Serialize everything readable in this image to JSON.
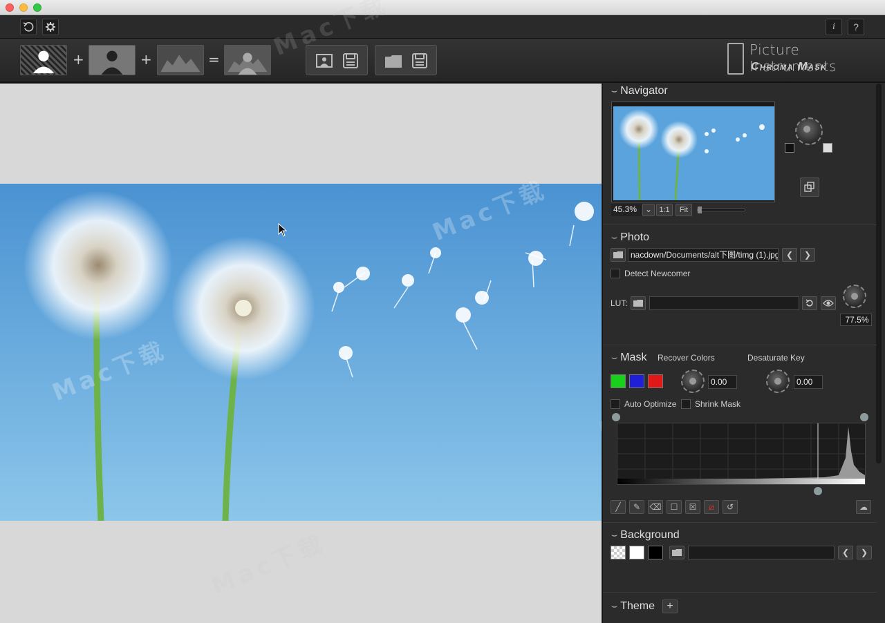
{
  "toolbar": {
    "reset_icon": "undo-icon",
    "settings_icon": "gear-icon",
    "info_label": "i",
    "help_label": "?",
    "plus1": "+",
    "plus2": "+",
    "equals": "="
  },
  "brand": {
    "line1": "Picture Instruments",
    "line2": "Chroma Mask"
  },
  "navigator": {
    "title": "Navigator",
    "zoom": "45.3%",
    "one_to_one": "1:1",
    "fit": "Fit"
  },
  "photo": {
    "title": "Photo",
    "path": "nacdown/Documents/alt下图/timg (1).jpg",
    "prev": "❮",
    "next": "❯",
    "detect_newcomer": "Detect Newcomer",
    "lut_label": "LUT:",
    "lut_value": "",
    "lut_strength": "77.5%"
  },
  "mask": {
    "title": "Mask",
    "recover_colors": "Recover Colors",
    "desaturate_key": "Desaturate Key",
    "recover_value": "0.00",
    "desaturate_value": "0.00",
    "auto_optimize": "Auto Optimize",
    "shrink_mask": "Shrink Mask",
    "colors": [
      "#19d11b",
      "#1f1fd8",
      "#e01818"
    ]
  },
  "background": {
    "title": "Background",
    "path": "",
    "prev": "❮",
    "next": "❯"
  },
  "theme": {
    "title": "Theme",
    "add": "+"
  },
  "watermark": "Mac下载"
}
